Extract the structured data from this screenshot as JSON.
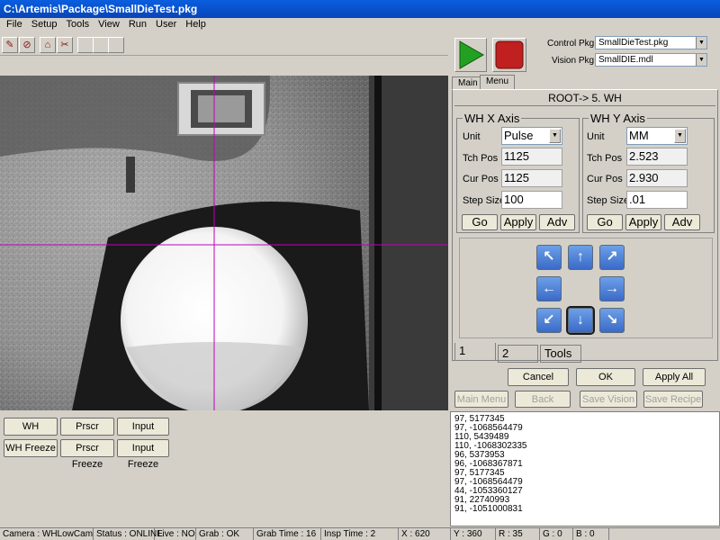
{
  "window": {
    "title": "C:\\Artemis\\Package\\SmallDieTest.pkg"
  },
  "menu": [
    "File",
    "Setup",
    "Tools",
    "View",
    "Run",
    "User",
    "Help"
  ],
  "packages": {
    "control_label": "Control Pkg",
    "control_value": "SmallDieTest.pkg",
    "vision_label": "Vision Pkg",
    "vision_value": "SmallDIE.mdl"
  },
  "tabs": [
    "Main",
    "Menu"
  ],
  "breadcrumb": "ROOT-> 5. WH",
  "x_axis": {
    "title": "WH X Axis",
    "unit_label": "Unit",
    "unit_value": "Pulse",
    "tch_label": "Tch Pos",
    "tch_value": "1125",
    "cur_label": "Cur Pos",
    "cur_value": "1125",
    "step_label": "Step Size",
    "step_value": "100",
    "go": "Go",
    "apply": "Apply",
    "adv": "Adv"
  },
  "y_axis": {
    "title": "WH Y Axis",
    "unit_label": "Unit",
    "unit_value": "MM",
    "tch_label": "Tch Pos",
    "tch_value": "2.523",
    "cur_label": "Cur Pos",
    "cur_value": "2.930",
    "step_label": "Step Size",
    "step_value": ".01",
    "go": "Go",
    "apply": "Apply",
    "adv": "Adv"
  },
  "jog_icons": [
    "arrow-up-left",
    "arrow-up",
    "arrow-up-right",
    "arrow-left",
    "arrow-right",
    "arrow-down-left",
    "arrow-down",
    "arrow-down-right"
  ],
  "subtabs": [
    "1",
    "2",
    "Tools"
  ],
  "dialog_buttons": {
    "cancel": "Cancel",
    "ok": "OK",
    "apply_all": "Apply All"
  },
  "nav_buttons": {
    "main_menu": "Main Menu",
    "back": "Back",
    "save_vision": "Save Vision",
    "save_recipe": "Save Recipe"
  },
  "camera_buttons": {
    "wh": "WH",
    "prscr": "Prscr",
    "input": "Input",
    "wh_freeze": "WH Freeze",
    "prscr_freeze": "Prscr Freeze",
    "input_freeze": "Input Freeze"
  },
  "log_lines": [
    "97, 5177345",
    "97, -1068564479",
    "110, 5439489",
    "110, -1068302335",
    "96, 5373953",
    "96, -1068367871",
    "97, 5177345",
    "97, -1068564479",
    "44, -1053360127",
    "91, 22740993",
    "91, -1051000831"
  ],
  "status": {
    "camera": "Camera : WHLowCam",
    "status": "Status : ONLINE",
    "live": "Live : NO",
    "grab": "Grab : OK",
    "grab_time": "Grab Time : 16",
    "insp_time": "Insp Time : 2",
    "x": "X : 620",
    "y": "Y : 360",
    "r": "R : 35",
    "g": "G : 0",
    "b": "B : 0"
  },
  "colors": {
    "title_bar": "#0a5ee0",
    "crosshair": "#c000c0",
    "play": "#22a022",
    "stop": "#c02020",
    "jog": "#3a6ac8"
  }
}
